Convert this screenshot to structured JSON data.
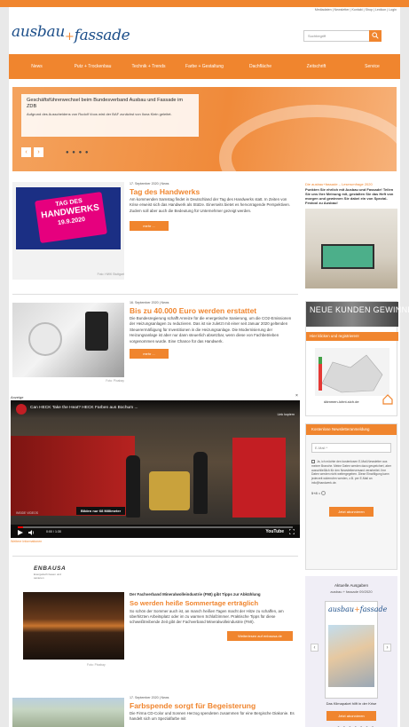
{
  "header": {
    "meta_links": "Mediadaten | Newsletter | Kontakt | Shop | Lexikon | Login",
    "logo_part1": "ausbau",
    "logo_plus": "+",
    "logo_part2": "fassade",
    "search_placeholder": "Suchbegriff"
  },
  "nav": {
    "items": [
      "News",
      "Putz + Trockenbau",
      "Technik + Trends",
      "Farbe + Gestaltung",
      "Dachfläche",
      "Zeitschrift",
      "Service"
    ]
  },
  "hero": {
    "title": "Geschäftsführerwechsel beim Bundesverband Ausbau und Fassade im ZDB",
    "subtitle": "Aufgrund des Ausscheidens von Rudolf Voos wird der BAF zunächst von Ilona Klein geleitet.",
    "prev": "‹",
    "next": "›",
    "dots": "● ● ● ●"
  },
  "articles": [
    {
      "meta": "17. September 2020 | News",
      "title": "Tag des Handwerks",
      "text": "Am kommenden Samstag findet in Deutschland der Tag des Handwerks statt. In Zeiten von Krise erweist sich das Handwerk als Stütze. Einerseits bietet es hervorragende Perspektiven. Zudem soll aber auch die Bedeutung für Unternehmer gezeigt werden.",
      "more": "mehr ...",
      "caption": "Foto: HWK Stuttgart",
      "sign_line1": "TAG DES",
      "sign_line2": "HANDWERKS",
      "sign_date": "19.9.2020"
    },
    {
      "meta": "16. September 2020 | News",
      "title": "Bis zu 40.000 Euro werden erstattet",
      "text": "Die Bundesregierung schafft Anreize für die energetische Sanierung, um die CO2-Emissionen der Heizungsanlagen zu reduzieren. Das ist sie zuletzt mit einer seit Januar 2020 geltenden Steuerermäßigung für Investitionen in die Heizungsanlage. Die Modernisierung der Heizungsanlage ist aber nur dann steuerlich absetzbar, wenn diese von Fachbetrieben vorgenommen wurde. Eine Chance für das Handwerk.",
      "more": "mehr ...",
      "caption": "Foto: Pixabay"
    },
    {
      "meta": "17. September 2020 | News",
      "title": "Farbspende sorgt für Begeisterung",
      "text": "Die Firma CD-Color und Sonnen Herzog spendeten zusammen für eine Bergische Diakonie. Es handelt sich um Spezialfarbe mit"
    }
  ],
  "ad": {
    "label": "Anzeige",
    "close": "×",
    "video_title": "Can HECK Take the Heat? HECK Farben aus Bochum ...",
    "link": "Link kopiern",
    "caption": "Bilden nur 68 Millimeter",
    "small": "INSIDE VIDEOS",
    "time": "0:00 / 1:30",
    "youtube": "YouTube",
    "progress": 0.02,
    "more_info": "Weitere Informationen"
  },
  "fmi": {
    "logo": "ENBAUSA",
    "logo_sub": "Energetisch bauen und sanieren",
    "pretitle": "Der Fachverband Mineralwolleindustrie (FMI) gibt Tipps zur Abkühlung",
    "title": "So werden heiße Sommertage erträglich",
    "text": "So schön der Sommer auch ist, an manch heißen Tagen macht der Hitze zu schaffen, am überhitzten Arbeitsplatz oder im zu warmen Schlafzimmer. Praktische Tipps für diese schweißtreibende Zeit gibt der Fachverband Mineralwolleindustrie (FMI).",
    "button": "Weiterlesen auf enbausa.de",
    "caption": "Foto: Pixabay"
  },
  "sidebar": {
    "survey_title": "Die ausbau+fassade – Leserumfrage 2020",
    "survey_text": "Punkten Sie ehrlich mit Ausbau und Fassade! Teilen Sie uns Ihre Meinung mit, gestalten Sie das Heft von morgen und gewinnen Sie dabei ein von Spezial-Festool zu Ausbau!",
    "kunden_title": "NEUE KUNDEN GEWINNEN",
    "kunden_btn": "Hier klicken und registrieren!",
    "kunden_foot": "dämmen-lohnt-sich.de",
    "newsletter_title": "Kostenlose Newsletteranmeldung",
    "newsletter_email": "E-Mail *",
    "newsletter_consent": "Ja, ich möchte den kostenlosen E-Mail-Newsletter aus meiner Branche. Meine Daten werden dazu gespeichert, aber ausschließlich für den Newsletterversand verarbeitet. Ihre Daten werden nicht weitergegeben. Diese Einwilligung kann jederzeit widerrufen werden, z.B. per E-Mail an info@handwerk.de.",
    "newsletter_captcha": "5+8 = ",
    "newsletter_btn": "Jetzt abonnieren",
    "issue_title": "Aktuelle Ausgaben",
    "issue_sub": "ausbau + fassade 09/2020",
    "issue_cap": "Das Klimapaket hilft in der Krise",
    "issue_btn": "Jetzt abonnieren",
    "issue_dots": "● ● ● ● ● ● ●"
  },
  "colors": {
    "accent": "#f0852e",
    "logo": "#1d4f8a"
  }
}
